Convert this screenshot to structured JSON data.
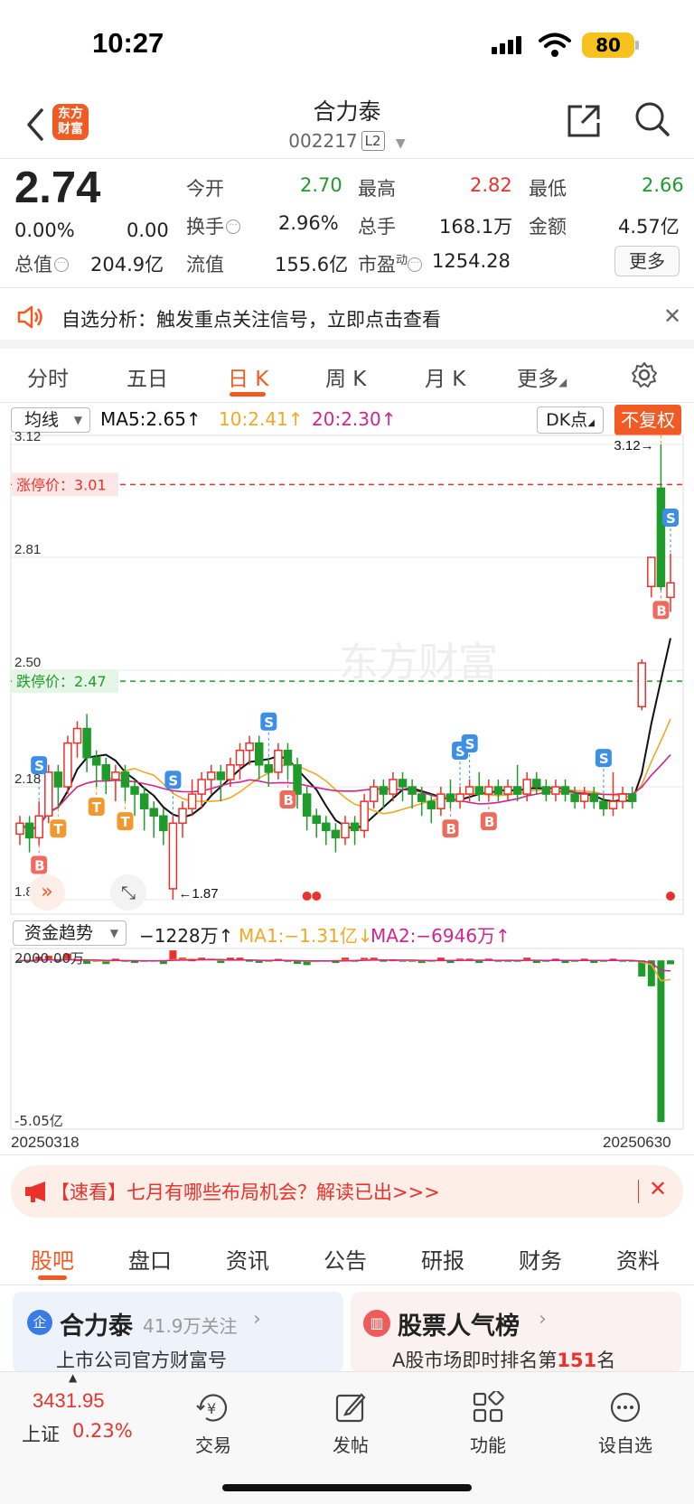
{
  "status_bar": {
    "time": "10:27",
    "battery": "80"
  },
  "header": {
    "name": "合力泰",
    "code": "002217",
    "level_badge": "L2",
    "logo_line1": "东方",
    "logo_line2": "财富"
  },
  "quote": {
    "price": "2.74",
    "change_pct": "0.00%",
    "change": "0.00",
    "open_label": "今开",
    "open": "2.70",
    "high_label": "最高",
    "high": "2.82",
    "low_label": "最低",
    "low": "2.66",
    "turnover_label": "换手",
    "turnover": "2.96%",
    "volume_label": "总手",
    "volume": "168.1万",
    "amount_label": "金额",
    "amount": "4.57亿",
    "total_cap_label": "总值",
    "total_cap": "204.9亿",
    "float_cap_label": "流值",
    "float_cap": "155.6亿",
    "pe_label": "市盈",
    "pe_sup": "动",
    "pe": "1254.28",
    "more_label": "更多"
  },
  "notice": {
    "text": "自选分析：触发重点关注信号，立即点击查看"
  },
  "period_tabs": [
    "分时",
    "五日",
    "日 K",
    "周 K",
    "月 K",
    "更多"
  ],
  "chart_header": {
    "indicator": "均线",
    "ma5": "MA5:2.65↑",
    "ma10": "10:2.41↑",
    "ma20": "20:2.30↑",
    "dk": "DK点",
    "adjust": "不复权"
  },
  "chart_data": [
    {
      "type": "candlestick",
      "title": "",
      "y_ticks": [
        "3.12",
        "2.81",
        "2.50",
        "2.18",
        "1.87"
      ],
      "ylim": [
        1.87,
        3.12
      ],
      "limit_up_label": "涨停价：3.01",
      "limit_down_label": "跌停价：2.47",
      "high_marker": "3.12→",
      "low_marker": "←1.87",
      "watermark": "东方财富",
      "signals": [
        {
          "label": "S",
          "color": "#3b8fe8"
        },
        {
          "label": "B",
          "color": "#ef6a5c"
        },
        {
          "label": "T",
          "color": "#f2982d"
        },
        {
          "label": "T",
          "color": "#f2982d"
        },
        {
          "label": "S",
          "color": "#3b8fe8"
        },
        {
          "label": "T",
          "color": "#f2982d"
        },
        {
          "label": "S",
          "color": "#3b8fe8"
        },
        {
          "label": "B",
          "color": "#ef6a5c"
        },
        {
          "label": "S",
          "color": "#3b8fe8"
        },
        {
          "label": "B",
          "color": "#ef6a5c"
        },
        {
          "label": "S",
          "color": "#3b8fe8"
        },
        {
          "label": "B",
          "color": "#ef6a5c"
        },
        {
          "label": "S",
          "color": "#3b8fe8"
        },
        {
          "label": "B",
          "color": "#ef6a5c"
        },
        {
          "label": "S",
          "color": "#3b8fe8"
        },
        {
          "label": "T",
          "color": "#f2982d"
        }
      ],
      "candles": [
        [
          2.05,
          2.08,
          2.02,
          2.1
        ],
        [
          2.08,
          2.04,
          2.0,
          2.1
        ],
        [
          2.04,
          2.1,
          2.02,
          2.14
        ],
        [
          2.1,
          2.22,
          2.08,
          2.24
        ],
        [
          2.22,
          2.18,
          2.12,
          2.24
        ],
        [
          2.18,
          2.3,
          2.16,
          2.32
        ],
        [
          2.3,
          2.34,
          2.26,
          2.36
        ],
        [
          2.34,
          2.26,
          2.22,
          2.38
        ],
        [
          2.26,
          2.24,
          2.18,
          2.28
        ],
        [
          2.24,
          2.2,
          2.16,
          2.26
        ],
        [
          2.2,
          2.22,
          2.14,
          2.24
        ],
        [
          2.22,
          2.18,
          2.14,
          2.24
        ],
        [
          2.18,
          2.16,
          2.1,
          2.2
        ],
        [
          2.16,
          2.12,
          2.06,
          2.18
        ],
        [
          2.12,
          2.1,
          2.04,
          2.14
        ],
        [
          2.1,
          2.06,
          2.02,
          2.12
        ],
        [
          1.9,
          2.08,
          1.87,
          2.1
        ],
        [
          2.08,
          2.12,
          2.04,
          2.14
        ],
        [
          2.12,
          2.16,
          2.1,
          2.2
        ],
        [
          2.16,
          2.2,
          2.12,
          2.22
        ],
        [
          2.2,
          2.22,
          2.16,
          2.24
        ],
        [
          2.22,
          2.2,
          2.14,
          2.24
        ],
        [
          2.2,
          2.24,
          2.18,
          2.26
        ],
        [
          2.24,
          2.28,
          2.2,
          2.3
        ],
        [
          2.28,
          2.3,
          2.24,
          2.32
        ],
        [
          2.3,
          2.24,
          2.2,
          2.32
        ],
        [
          2.24,
          2.22,
          2.18,
          2.26
        ],
        [
          2.22,
          2.28,
          2.2,
          2.3
        ],
        [
          2.28,
          2.24,
          2.2,
          2.3
        ],
        [
          2.24,
          2.16,
          2.12,
          2.26
        ],
        [
          2.16,
          2.1,
          2.06,
          2.18
        ],
        [
          2.1,
          2.08,
          2.04,
          2.12
        ],
        [
          2.08,
          2.06,
          2.02,
          2.1
        ],
        [
          2.06,
          2.04,
          2.0,
          2.08
        ],
        [
          2.04,
          2.08,
          2.02,
          2.1
        ],
        [
          2.08,
          2.06,
          2.02,
          2.1
        ],
        [
          2.06,
          2.14,
          2.04,
          2.16
        ],
        [
          2.14,
          2.18,
          2.12,
          2.2
        ],
        [
          2.18,
          2.16,
          2.12,
          2.2
        ],
        [
          2.16,
          2.2,
          2.14,
          2.22
        ],
        [
          2.2,
          2.18,
          2.14,
          2.22
        ],
        [
          2.18,
          2.16,
          2.12,
          2.2
        ],
        [
          2.16,
          2.14,
          2.1,
          2.18
        ],
        [
          2.14,
          2.12,
          2.08,
          2.16
        ],
        [
          2.12,
          2.16,
          2.1,
          2.18
        ],
        [
          2.16,
          2.14,
          2.12,
          2.2
        ],
        [
          2.14,
          2.16,
          2.12,
          2.18
        ],
        [
          2.16,
          2.18,
          2.14,
          2.2
        ],
        [
          2.18,
          2.16,
          2.14,
          2.22
        ],
        [
          2.16,
          2.18,
          2.14,
          2.2
        ],
        [
          2.18,
          2.16,
          2.14,
          2.2
        ],
        [
          2.16,
          2.18,
          2.14,
          2.2
        ],
        [
          2.18,
          2.16,
          2.14,
          2.24
        ],
        [
          2.16,
          2.2,
          2.14,
          2.22
        ],
        [
          2.2,
          2.18,
          2.16,
          2.22
        ],
        [
          2.18,
          2.16,
          2.14,
          2.2
        ],
        [
          2.16,
          2.18,
          2.14,
          2.2
        ],
        [
          2.18,
          2.16,
          2.14,
          2.2
        ],
        [
          2.16,
          2.14,
          2.12,
          2.18
        ],
        [
          2.14,
          2.16,
          2.12,
          2.18
        ],
        [
          2.16,
          2.14,
          2.12,
          2.18
        ],
        [
          2.14,
          2.12,
          2.1,
          2.16
        ],
        [
          2.12,
          2.14,
          2.1,
          2.22
        ],
        [
          2.14,
          2.16,
          2.12,
          2.18
        ],
        [
          2.16,
          2.14,
          2.12,
          2.18
        ],
        [
          2.4,
          2.52,
          2.39,
          2.53
        ],
        [
          2.73,
          2.81,
          2.7,
          2.81
        ],
        [
          3.0,
          2.73,
          2.72,
          3.12
        ],
        [
          2.7,
          2.74,
          2.66,
          2.82
        ]
      ]
    },
    {
      "type": "bar",
      "title": "",
      "indicator": "资金趋势",
      "value": "−1228万↑",
      "ma1": "MA1:−1.31亿↓",
      "ma2": "MA2:−6946万↑",
      "y_ticks": [
        "2000.00万",
        "-5.05亿"
      ],
      "ylim": [
        -5.05,
        0.2
      ],
      "x_start": "20250318",
      "x_end": "20250630"
    }
  ],
  "promo": {
    "text": "【速看】七月有哪些布局机会？解读已出>>>"
  },
  "bottom_tabs": [
    "股吧",
    "盘口",
    "资讯",
    "公告",
    "研报",
    "财务",
    "资料"
  ],
  "card1": {
    "title": "合力泰",
    "followers": "41.9万关注",
    "subtitle": "上市公司官方财富号",
    "badge": "企"
  },
  "card2": {
    "title": "股票人气榜",
    "subtitle_prefix": "A股市场即时排名第",
    "rank": "151",
    "subtitle_suffix": "名"
  },
  "bottom_nav": {
    "index_value": "3431.95",
    "index_name": "上证",
    "index_change": "0.23%",
    "trade": "交易",
    "post": "发帖",
    "function": "功能",
    "watchlist": "设自选"
  },
  "colors": {
    "up": "#e8322b",
    "down": "#1f9b2b",
    "accent": "#f15a22",
    "ma5": "#111111",
    "ma10": "#f2a922",
    "ma20": "#d0258f"
  }
}
